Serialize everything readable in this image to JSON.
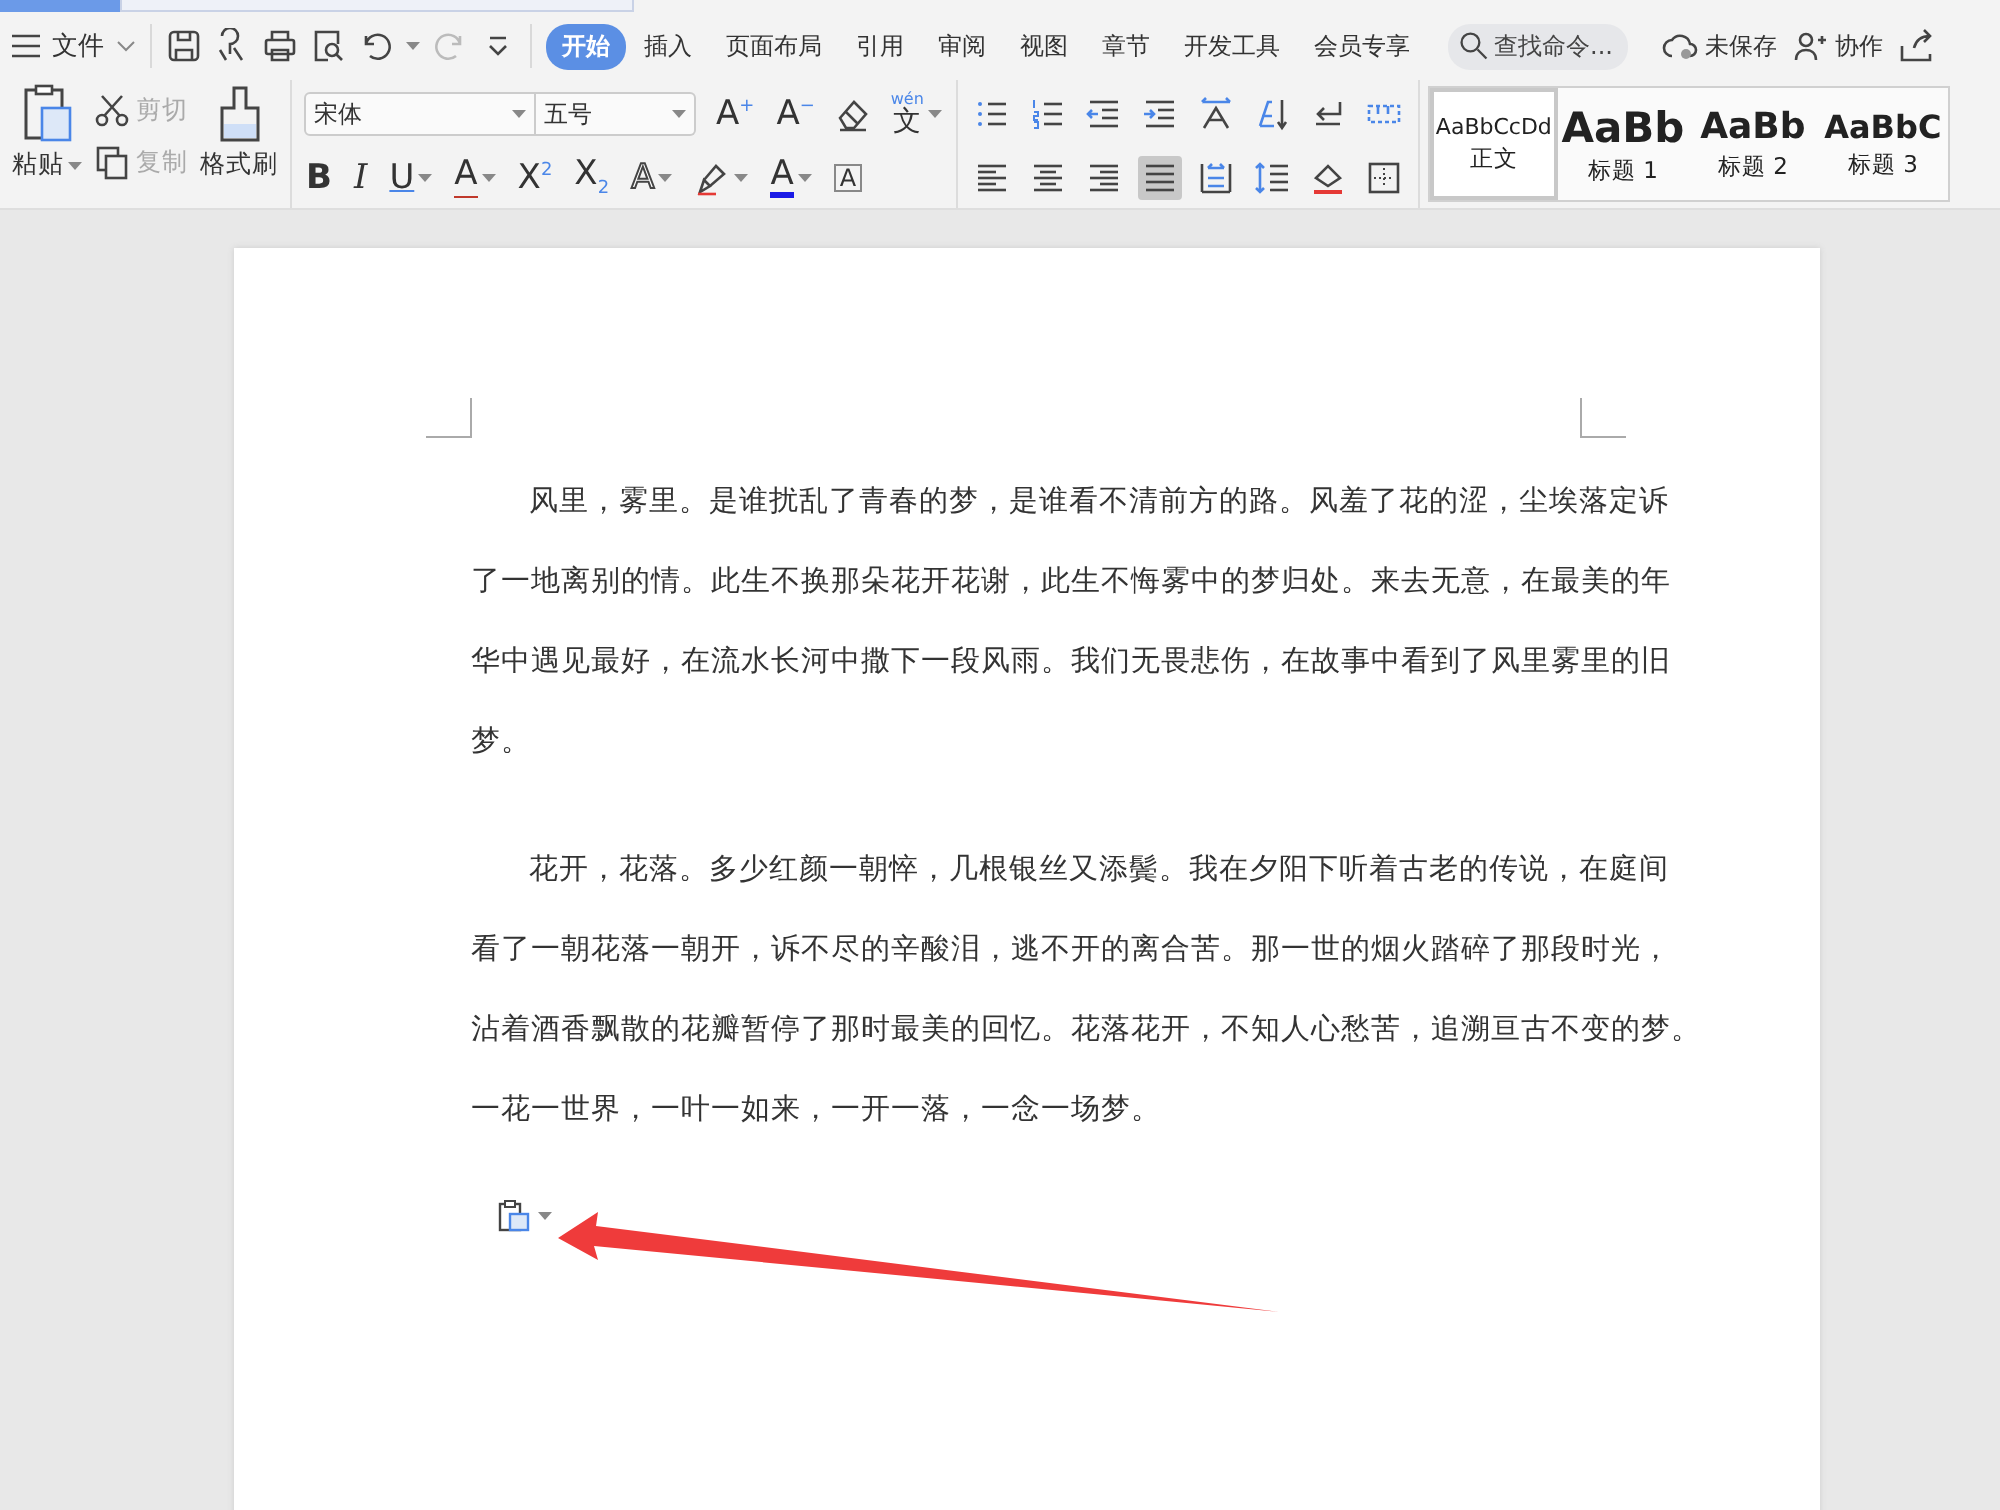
{
  "menu": {
    "file": "文件"
  },
  "tabs": [
    {
      "label": "开始",
      "selected": true
    },
    {
      "label": "插入",
      "selected": false
    },
    {
      "label": "页面布局",
      "selected": false
    },
    {
      "label": "引用",
      "selected": false
    },
    {
      "label": "审阅",
      "selected": false
    },
    {
      "label": "视图",
      "selected": false
    },
    {
      "label": "章节",
      "selected": false
    },
    {
      "label": "开发工具",
      "selected": false
    },
    {
      "label": "会员专享",
      "selected": false
    }
  ],
  "search": {
    "placeholder": "查找命令..."
  },
  "status": {
    "save": "未保存",
    "collab": "协作"
  },
  "clipboard": {
    "paste": "粘贴",
    "cut": {
      "label": "剪切",
      "disabled": true
    },
    "copy": {
      "label": "复制",
      "disabled": true
    },
    "painter": "格式刷"
  },
  "font": {
    "family": "宋体",
    "size": "五号",
    "row1": [
      {
        "kind": "grow",
        "glyph": "A$^{+}$"
      },
      {
        "kind": "shrink",
        "glyph": "A$^{−}$"
      },
      {
        "kind": "eraser"
      },
      {
        "kind": "phonetic",
        "glyph": "文",
        "ruby": "wén"
      }
    ],
    "row2": [
      {
        "kind": "bold",
        "glyph": "B"
      },
      {
        "kind": "italic",
        "glyph": "I"
      },
      {
        "kind": "underline",
        "glyph": "U"
      },
      {
        "kind": "strike",
        "glyph": "A"
      },
      {
        "kind": "sup",
        "glyph": "X$^{2}$"
      },
      {
        "kind": "sub",
        "glyph": "X$_{2}$"
      },
      {
        "kind": "effect",
        "glyph": "A"
      },
      {
        "kind": "highlight"
      },
      {
        "kind": "color",
        "glyph": "A"
      },
      {
        "kind": "boxed",
        "glyph": "A"
      }
    ]
  },
  "paragraph": {
    "row1": [
      {
        "kind": "bullets",
        "selected": false
      },
      {
        "kind": "numbers",
        "selected": false
      },
      {
        "kind": "outdent",
        "selected": false
      },
      {
        "kind": "indent",
        "selected": false
      },
      {
        "kind": "layout",
        "selected": false
      },
      {
        "kind": "sort",
        "selected": false
      },
      {
        "kind": "linebreak",
        "selected": false
      },
      {
        "kind": "ruler",
        "selected": false
      }
    ],
    "row2": [
      {
        "kind": "left",
        "selected": false
      },
      {
        "kind": "center",
        "selected": false
      },
      {
        "kind": "right",
        "selected": false
      },
      {
        "kind": "justify",
        "selected": true
      },
      {
        "kind": "distribute",
        "selected": false
      },
      {
        "kind": "spacing",
        "selected": false
      },
      {
        "kind": "shading",
        "selected": false
      },
      {
        "kind": "border",
        "selected": false
      }
    ]
  },
  "styles": [
    {
      "preview": "AaBbCcDd",
      "name": "正文",
      "selected": true,
      "kind": "body"
    },
    {
      "preview": "AaBb",
      "name": "标题 1",
      "selected": false,
      "kind": "h1"
    },
    {
      "preview": "AaBb",
      "name": "标题 2",
      "selected": false,
      "kind": "h2"
    },
    {
      "preview": "AaBbC",
      "name": "标题 3",
      "selected": false,
      "kind": "h3"
    }
  ],
  "document": {
    "paragraphs": [
      [
        "风里，雾里。是谁扰乱了青春的梦，是谁看不清前方的路。风羞了花的涩，尘埃落定诉",
        "了一地离别的情。此生不换那朵花开花谢，此生不悔雾中的梦归处。来去无意，在最美的年",
        "华中遇见最好，在流水长河中撒下一段风雨。我们无畏悲伤，在故事中看到了风里雾里的旧",
        "梦。"
      ],
      [
        "花开，花落。多少红颜一朝悴，几根银丝又添鬓。我在夕阳下听着古老的传说，在庭间",
        "看了一朝花落一朝开，诉不尽的辛酸泪，逃不开的离合苦。那一世的烟火踏碎了那段时光，",
        "沾着酒香飘散的花瓣暂停了那时最美的回忆。花落花开，不知人心愁苦，追溯亘古不变的梦。",
        "一花一世界，一叶一如来，一开一落，一念一场梦。"
      ]
    ]
  }
}
